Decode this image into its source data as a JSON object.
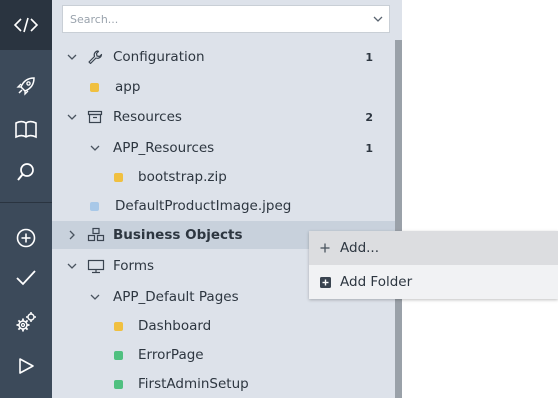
{
  "iconbar": {
    "items": [
      {
        "icon": "code-icon"
      },
      {
        "icon": "rocket-icon"
      },
      {
        "icon": "book-icon"
      },
      {
        "icon": "search-icon"
      },
      {
        "icon": "add-circle-icon"
      },
      {
        "icon": "check-icon"
      },
      {
        "icon": "gears-icon"
      },
      {
        "icon": "play-icon"
      }
    ],
    "colors": {
      "bar": "#3c4a5a",
      "active": "#2a3440",
      "icon": "#ffffff"
    }
  },
  "search": {
    "placeholder": "Search..."
  },
  "tree": {
    "configuration": {
      "label": "Configuration",
      "count": "1"
    },
    "app": {
      "label": "app"
    },
    "resources": {
      "label": "Resources",
      "count": "2"
    },
    "app_resources": {
      "label": "APP_Resources",
      "count": "1"
    },
    "bootstrap": {
      "label": "bootstrap.zip"
    },
    "default_image": {
      "label": "DefaultProductImage.jpeg"
    },
    "business_objects": {
      "label": "Business Objects"
    },
    "forms": {
      "label": "Forms"
    },
    "app_default_pages": {
      "label": "APP_Default Pages"
    },
    "dashboard": {
      "label": "Dashboard"
    },
    "error_page": {
      "label": "ErrorPage"
    },
    "first_admin": {
      "label": "FirstAdminSetup"
    }
  },
  "context_menu": {
    "add": {
      "label": "Add..."
    },
    "add_folder": {
      "label": "Add Folder"
    }
  },
  "colors": {
    "yellow": "#f0c040",
    "blue": "#a8c8e8",
    "green": "#50c080",
    "panel": "#dde2ea",
    "selected": "#c8d1dc"
  }
}
